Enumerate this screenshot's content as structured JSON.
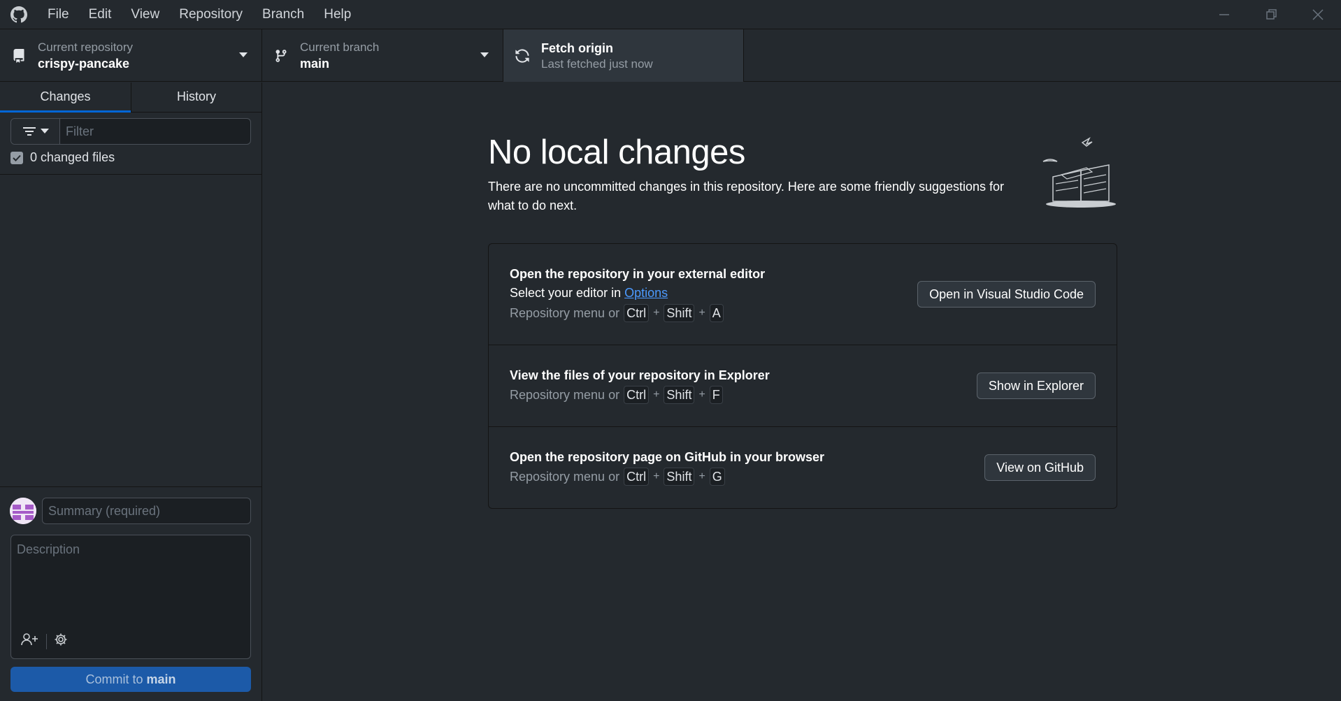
{
  "menu": {
    "items": [
      "File",
      "Edit",
      "View",
      "Repository",
      "Branch",
      "Help"
    ]
  },
  "toolbar": {
    "repo_label": "Current repository",
    "repo_value": "crispy-pancake",
    "branch_label": "Current branch",
    "branch_value": "main",
    "fetch_title": "Fetch origin",
    "fetch_status": "Last fetched just now"
  },
  "sidebar": {
    "tabs": [
      "Changes",
      "History"
    ],
    "active_tab": "Changes",
    "filter_placeholder": "Filter",
    "changed_files_label": "0 changed files",
    "summary_placeholder": "Summary (required)",
    "description_placeholder": "Description",
    "commit_prefix": "Commit to ",
    "commit_branch": "main"
  },
  "main": {
    "title": "No local changes",
    "subtitle": "There are no uncommitted changes in this repository. Here are some friendly suggestions for what to do next.",
    "actions": [
      {
        "title": "Open the repository in your external editor",
        "desc_prefix": "Select your editor in ",
        "desc_link": "Options",
        "shortcut_prefix": "Repository menu or",
        "keys": [
          "Ctrl",
          "Shift",
          "A"
        ],
        "button": "Open in Visual Studio Code"
      },
      {
        "title": "View the files of your repository in Explorer",
        "shortcut_prefix": "Repository menu or",
        "keys": [
          "Ctrl",
          "Shift",
          "F"
        ],
        "button": "Show in Explorer"
      },
      {
        "title": "Open the repository page on GitHub in your browser",
        "shortcut_prefix": "Repository menu or",
        "keys": [
          "Ctrl",
          "Shift",
          "G"
        ],
        "button": "View on GitHub"
      }
    ]
  },
  "colors": {
    "background": "#24292e",
    "accent": "#0366d6",
    "commit_button": "#1c5aa8",
    "link": "#4c9aff"
  },
  "icons": [
    "github-logo-icon",
    "minimize-icon",
    "maximize-icon",
    "close-icon",
    "repo-icon",
    "branch-icon",
    "sync-icon",
    "filter-icon",
    "checkmark-icon",
    "add-coauthor-icon",
    "gear-icon"
  ]
}
